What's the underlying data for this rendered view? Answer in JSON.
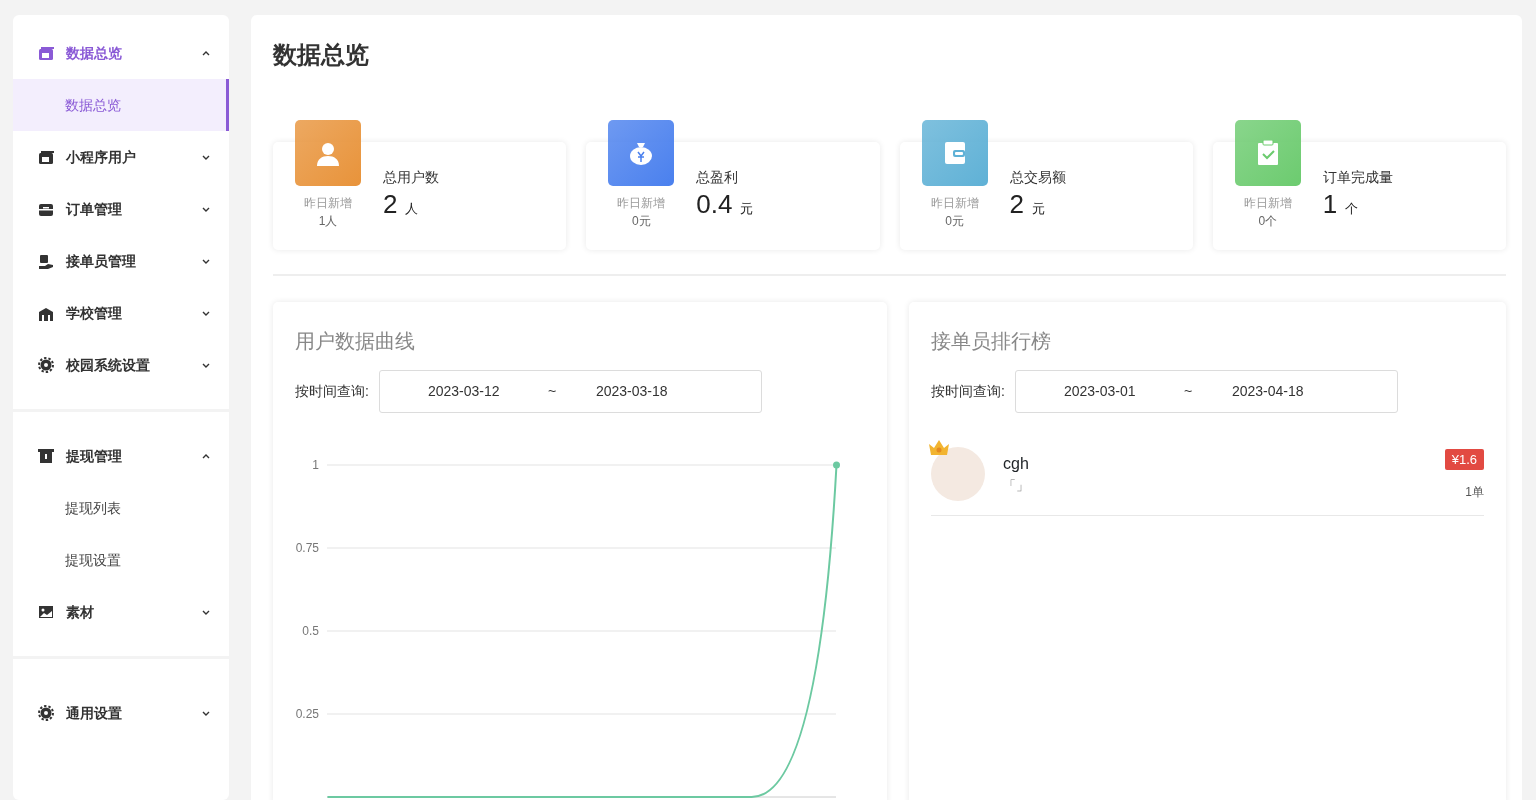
{
  "sidebar": {
    "groups": [
      {
        "items": [
          {
            "kind": "dashboard",
            "label": "数据总览",
            "active": true,
            "expanded": true,
            "children": [
              {
                "label": "数据总览",
                "selected": true
              }
            ]
          },
          {
            "kind": "dashboard",
            "label": "小程序用户",
            "active": false,
            "expanded": false
          },
          {
            "kind": "briefcase",
            "label": "订单管理",
            "active": false,
            "expanded": false
          },
          {
            "kind": "hand",
            "label": "接单员管理",
            "active": false,
            "expanded": false
          },
          {
            "kind": "school",
            "label": "学校管理",
            "active": false,
            "expanded": false
          },
          {
            "kind": "gear",
            "label": "校园系统设置",
            "active": false,
            "expanded": false
          }
        ]
      },
      {
        "items": [
          {
            "kind": "atm",
            "label": "提现管理",
            "active": false,
            "expanded": true,
            "children": [
              {
                "label": "提现列表",
                "selected": false
              },
              {
                "label": "提现设置",
                "selected": false
              }
            ]
          },
          {
            "kind": "image",
            "label": "素材",
            "active": false,
            "expanded": false
          }
        ]
      },
      {
        "items": [
          {
            "kind": "gear",
            "label": "通用设置",
            "active": false,
            "expanded": false
          }
        ]
      }
    ]
  },
  "page_title": "数据总览",
  "stats": [
    {
      "kind": "user",
      "color": "#e8933a",
      "label": "总用户数",
      "value": "2",
      "unit": "人",
      "sub_label": "昨日新增",
      "sub_value": "1人"
    },
    {
      "kind": "moneybag",
      "color": "#4a80ee",
      "label": "总盈利",
      "value": "0.4",
      "unit": "元",
      "sub_label": "昨日新增",
      "sub_value": "0元"
    },
    {
      "kind": "wallet",
      "color": "#5fb1d6",
      "label": "总交易额",
      "value": "2",
      "unit": "元",
      "sub_label": "昨日新增",
      "sub_value": "0元"
    },
    {
      "kind": "clipboard",
      "color": "#6ccb6f",
      "label": "订单完成量",
      "value": "1",
      "unit": "个",
      "sub_label": "昨日新增",
      "sub_value": "0个"
    }
  ],
  "user_chart": {
    "title": "用户数据曲线",
    "query_label": "按时间查询:",
    "start_date": "2023-03-12",
    "separator": "~",
    "end_date": "2023-03-18",
    "chart_data": {
      "type": "line",
      "grid": true,
      "ylim": [
        0,
        1
      ],
      "yticks": [
        {
          "value": 1,
          "label": "1"
        },
        {
          "value": 0.75,
          "label": "0.75"
        },
        {
          "value": 0.5,
          "label": "0.5"
        },
        {
          "value": 0.25,
          "label": "0.25"
        }
      ],
      "series": [
        {
          "color": "#6cc9a1",
          "values": [
            0,
            0,
            0,
            0,
            0,
            0,
            1
          ]
        }
      ]
    }
  },
  "ranking": {
    "title": "接单员排行榜",
    "query_label": "按时间查询:",
    "start_date": "2023-03-01",
    "separator": "~",
    "end_date": "2023-04-18",
    "rows": [
      {
        "name": "cgh",
        "note": "「」",
        "amount": "¥1.6",
        "orders": "1单",
        "crown": true
      }
    ]
  }
}
